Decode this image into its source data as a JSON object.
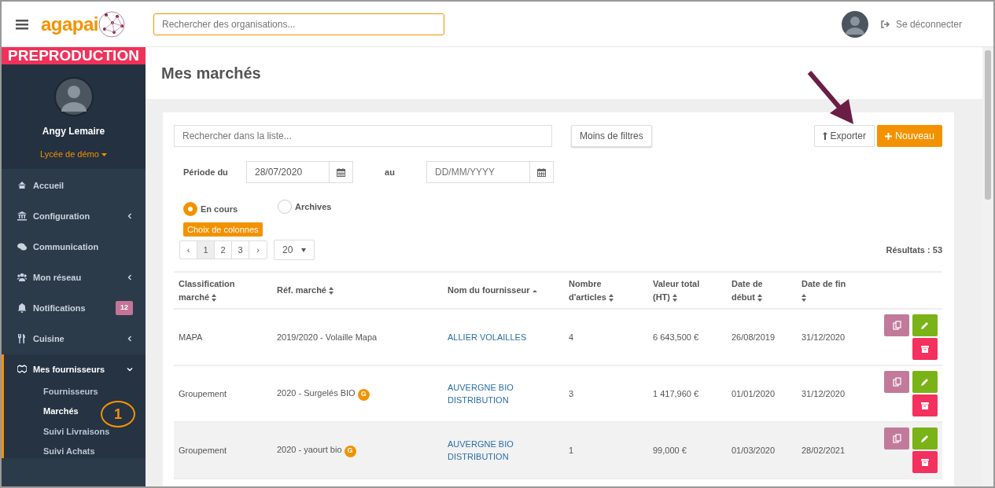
{
  "topbar": {
    "logo": "agapai",
    "search": {
      "placeholder": "Rechercher des organisations..."
    },
    "logout": "Se déconnecter"
  },
  "sidebar": {
    "environment": "PREPRODUCTION",
    "user": {
      "name": "Angy Lemaire",
      "organisation": "Lycée de démo"
    },
    "items": [
      {
        "label": "Accueil",
        "kind": "link",
        "selected": false
      },
      {
        "label": "Configuration",
        "kind": "group",
        "expanded": false,
        "selected": false
      },
      {
        "label": "Communication",
        "kind": "link",
        "selected": false
      },
      {
        "label": "Mon réseau",
        "kind": "group",
        "expanded": false,
        "selected": false
      },
      {
        "label": "Notifications",
        "kind": "link",
        "badge": "12",
        "selected": false
      },
      {
        "label": "Cuisine",
        "kind": "group",
        "expanded": false,
        "selected": false
      },
      {
        "label": "Mes fournisseurs",
        "kind": "group",
        "expanded": true,
        "selected": true,
        "children": [
          {
            "label": "Fournisseurs",
            "selected": false
          },
          {
            "label": "Marchés",
            "selected": true
          },
          {
            "label": "Suivi Livraisons",
            "selected": false
          },
          {
            "label": "Suivi Achats",
            "selected": false
          }
        ]
      }
    ]
  },
  "annotations": [
    {
      "kind": "number",
      "text": "1"
    },
    {
      "kind": "arrow"
    }
  ],
  "page": {
    "title": "Mes marchés"
  },
  "filters": {
    "search": {
      "placeholder": "Rechercher dans la liste..."
    },
    "toggle_button": "Moins de filtres",
    "export_button": "Exporter",
    "new_button": "Nouveau",
    "period_label": "Période du",
    "period_from": "28/07/2020",
    "period_to_label": "au",
    "period_to": {
      "placeholder": "DD/MM/YYYY"
    },
    "radios": [
      {
        "label": "En cours",
        "selected": true
      },
      {
        "label": "Archives",
        "selected": false
      }
    ],
    "columns_button": "Choix de colonnes"
  },
  "pagination": {
    "prev": "‹",
    "next": "›",
    "pages": [
      {
        "label": "1",
        "selected": true
      },
      {
        "label": "2",
        "selected": false
      },
      {
        "label": "3",
        "selected": false
      }
    ],
    "page_size": "20"
  },
  "results": "Résultats : 53",
  "table": {
    "columns": [
      {
        "label": "Classification marché",
        "sorted": false
      },
      {
        "label": "Réf. marché",
        "sorted": false
      },
      {
        "label": "Nom du fournisseur",
        "sorted": true
      },
      {
        "label": "Nombre d'articles",
        "sorted": false
      },
      {
        "label": "Valeur total (HT)",
        "sorted": false
      },
      {
        "label": "Date de début",
        "sorted": false
      },
      {
        "label": "Date de fin",
        "sorted": false
      }
    ],
    "rows": [
      {
        "classification": "MAPA",
        "reference": "2019/2020 - Volaille Mapa",
        "group_badge": null,
        "supplier": "ALLIER VOLAILLES",
        "articles": "4",
        "value": "6 643,500 €",
        "start": "26/08/2019",
        "end": "31/12/2020",
        "highlighted": false
      },
      {
        "classification": "Groupement",
        "reference": "2020 - Surgelés BIO",
        "group_badge": "G",
        "supplier": "AUVERGNE BIO DISTRIBUTION",
        "articles": "3",
        "value": "1 417,960 €",
        "start": "01/01/2020",
        "end": "31/12/2020",
        "highlighted": false
      },
      {
        "classification": "Groupement",
        "reference": "2020 - yaourt bio",
        "group_badge": "G",
        "supplier": "AUVERGNE BIO DISTRIBUTION",
        "articles": "1",
        "value": "99,000 €",
        "start": "01/03/2020",
        "end": "28/02/2021",
        "highlighted": true
      }
    ]
  }
}
